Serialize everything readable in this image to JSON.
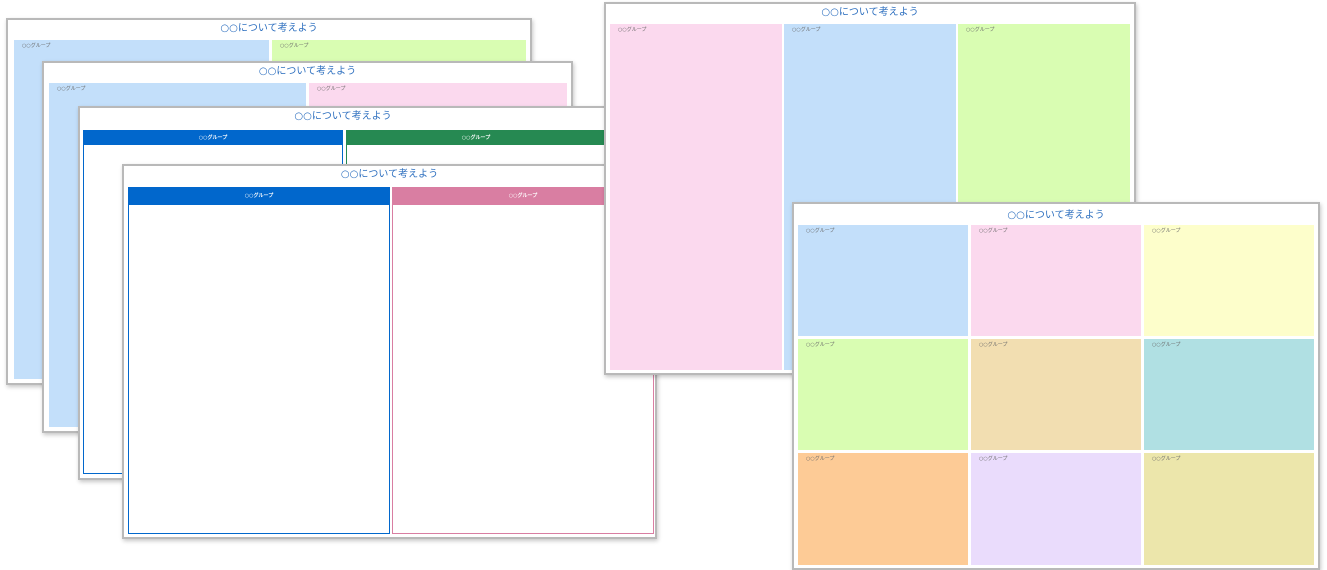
{
  "sheet_title": "○○について考えよう",
  "group_label": "○○グループ",
  "colors": {
    "title_text": "#2d6fbf",
    "blue_light": "#c3dffa",
    "pink_light": "#fbd9ee",
    "green_light": "#d9fdb2",
    "yellow_light": "#fdfecb",
    "tan_light": "#f2deb1",
    "teal_light": "#b0e0e3",
    "orange_light": "#fdcb96",
    "lavender_light": "#eadcfc",
    "khaki_light": "#ece6ab",
    "blue_header": "#0167cc",
    "green_header": "#268952",
    "pink_header": "#d97ea2"
  }
}
